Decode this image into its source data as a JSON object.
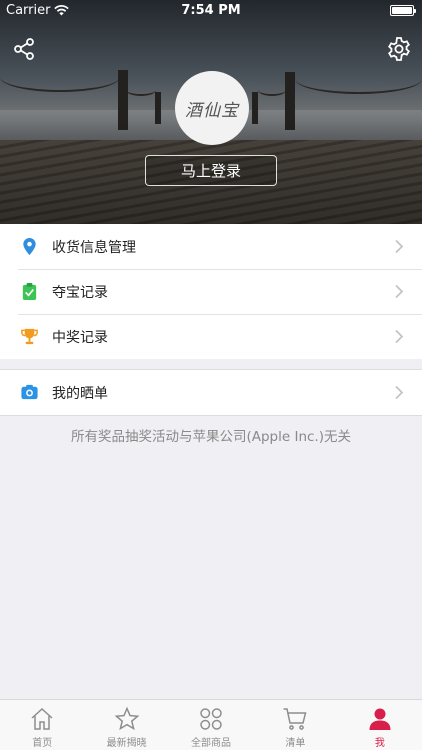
{
  "status_bar": {
    "carrier": "Carrier",
    "time": "7:54 PM"
  },
  "header": {
    "avatar_text": "酒仙宝",
    "login_label": "马上登录"
  },
  "menu_group1": [
    {
      "label": "收货信息管理",
      "icon": "location-pin-icon",
      "color": "#2f8ee0"
    },
    {
      "label": "夺宝记录",
      "icon": "clipboard-check-icon",
      "color": "#3cc457"
    },
    {
      "label": "中奖记录",
      "icon": "trophy-icon",
      "color": "#f29b1e"
    }
  ],
  "menu_group2": [
    {
      "label": "我的晒单",
      "icon": "camera-icon",
      "color": "#2a93e6"
    }
  ],
  "disclaimer": "所有奖品抽奖活动与苹果公司(Apple Inc.)无关",
  "tabs": [
    {
      "label": "首页",
      "icon": "home-icon",
      "active": false
    },
    {
      "label": "最新揭晓",
      "icon": "star-icon",
      "active": false
    },
    {
      "label": "全部商品",
      "icon": "grid-icon",
      "active": false
    },
    {
      "label": "清单",
      "icon": "cart-icon",
      "active": false
    },
    {
      "label": "我",
      "icon": "person-icon",
      "active": true
    }
  ],
  "colors": {
    "accent": "#d81e4a",
    "inactive_tab": "#8d8d8d"
  }
}
